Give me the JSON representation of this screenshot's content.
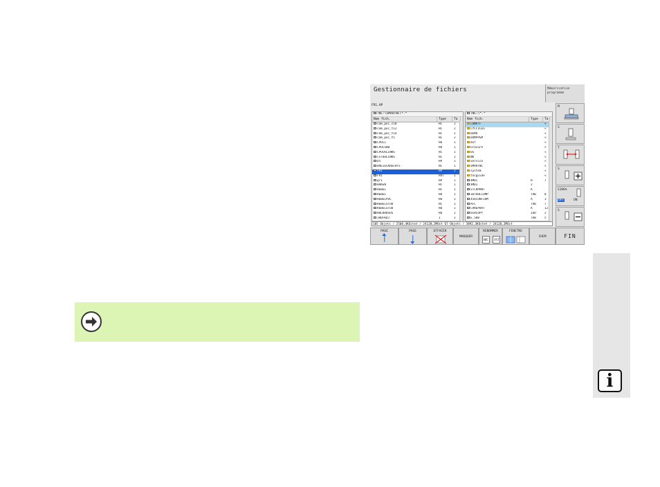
{
  "screen": {
    "title": "Gestionnaire de fichiers",
    "mode_label": "Mémorisation programme",
    "selected_program": "FR1.HP",
    "left_panel": {
      "path": "TNC:\\SMARTNC\\*.*",
      "columns": [
        "Nom fich.",
        "Type",
        "Ta"
      ],
      "rows": [
        {
          "name": "cam_poc_c50",
          "type": "HC",
          "size": "1"
        },
        {
          "name": "cam_poc_t12",
          "type": "HC",
          "size": "2"
        },
        {
          "name": "cam_poc_t14",
          "type": "HC",
          "size": "2"
        },
        {
          "name": "cam_poc_t5",
          "type": "HC",
          "size": "2"
        },
        {
          "name": "CPOC1",
          "type": "HU",
          "size": "1"
        },
        {
          "name": "CPOCSHB",
          "type": "HU",
          "size": "1"
        },
        {
          "name": "CPOCKLINKS",
          "type": "HC",
          "size": "1"
        },
        {
          "name": "CSTUDLINKS",
          "type": "HC",
          "size": "1"
        },
        {
          "name": "D5",
          "type": "HP",
          "size": "1"
        },
        {
          "name": "DREIECKRECHTS",
          "type": "HC",
          "size": "1"
        },
        {
          "name": "FR1",
          "type": "HP",
          "size": "2"
        },
        {
          "name": "FR1",
          "type": "HVT",
          "size": "1"
        },
        {
          "name": "gr1",
          "type": "HP",
          "size": "1"
        },
        {
          "name": "HAKEN",
          "type": "HC",
          "size": "1"
        },
        {
          "name": "HEBEL",
          "type": "HC",
          "size": "1"
        },
        {
          "name": "HEBEL",
          "type": "HU",
          "size": "1"
        },
        {
          "name": "HEBELPOC",
          "type": "HU",
          "size": "1"
        },
        {
          "name": "HEBELSTUD",
          "type": "HC",
          "size": "1"
        },
        {
          "name": "HEBELSTUD",
          "type": "HU",
          "size": "1"
        },
        {
          "name": "HOLKRDSUS",
          "type": "HU",
          "size": "1"
        },
        {
          "name": "JHDFKDJ",
          "type": "I",
          "size": "1"
        }
      ]
    },
    "right_panel": {
      "path": "TNC:\\*.*",
      "columns": [
        "Nom fich.",
        "Type",
        "Ta"
      ],
      "rows": [
        {
          "name": "CONVTF",
          "type": "",
          "size": "<",
          "folder": true
        },
        {
          "name": "CYCFILES",
          "type": "",
          "size": "<",
          "folder": true
        },
        {
          "name": "DEMO",
          "type": "",
          "size": "<",
          "folder": true
        },
        {
          "name": "DUMPPGM",
          "type": "",
          "size": "<",
          "folder": true
        },
        {
          "name": "dxf",
          "type": "",
          "size": "<",
          "folder": true
        },
        {
          "name": "Gravure",
          "type": "",
          "size": "<",
          "folder": true
        },
        {
          "name": "OS",
          "type": "",
          "size": "<",
          "folder": true
        },
        {
          "name": "NK",
          "type": "",
          "size": "<",
          "folder": true
        },
        {
          "name": "Service",
          "type": "",
          "size": "<",
          "folder": true
        },
        {
          "name": "SMARTNC",
          "type": "",
          "size": "<",
          "folder": true
        },
        {
          "name": "system",
          "type": "",
          "size": "<",
          "folder": true
        },
        {
          "name": "tncguide",
          "type": "",
          "size": "<",
          "folder": true
        },
        {
          "name": "$MDI",
          "type": "H",
          "size": "7",
          "folder": false
        },
        {
          "name": "$MDI",
          "type": "I",
          "size": "",
          "folder": false
        },
        {
          "name": "STCHPRNT",
          "type": "A",
          "size": "",
          "folder": false
        },
        {
          "name": "3DTOOLCOMP",
          "type": "TAB",
          "size": "8",
          "folder": false
        },
        {
          "name": "4S4CONFIRM",
          "type": "A",
          "size": "3",
          "folder": false
        },
        {
          "name": "AFC",
          "type": "TAB",
          "size": "7",
          "folder": false
        },
        {
          "name": "CVREPORT",
          "type": "A",
          "size": "12",
          "folder": false
        },
        {
          "name": "DIRCOPY",
          "type": "JOU",
          "size": "2",
          "folder": false
        },
        {
          "name": "E_500",
          "type": "TAB",
          "size": "5",
          "folder": false
        }
      ]
    },
    "status": "105 Objets / 2508,4KOctet / 24120,2MOct   67 Objets / 3892,3KOctet / 24120,2MOct",
    "vertical_softkeys": [
      {
        "label": "M",
        "icon": "m-function-icon"
      },
      {
        "label": "S",
        "icon": "spindle-icon"
      },
      {
        "label": "T",
        "icon": "tool-axis-icon"
      },
      {
        "label": "S",
        "icon": "spindle-override-plus-icon"
      },
      {
        "label": "S100%",
        "icon": "override-off-on-icon",
        "off": "OFF",
        "on": "ON"
      },
      {
        "label": "S",
        "icon": "spindle-override-minus-icon"
      }
    ],
    "softkeys": [
      {
        "label": "PAGE",
        "icon": "arrow-up-icon"
      },
      {
        "label": "PAGE",
        "icon": "arrow-down-icon"
      },
      {
        "label": "EFFACER",
        "icon": "delete-icon"
      },
      {
        "label": "MARQUER",
        "icon": ""
      },
      {
        "label": "RENOMMER",
        "icon": "rename-icon",
        "from": "ABC",
        "to": "XYZ"
      },
      {
        "label": "FENETRE",
        "icon": "window-icon"
      },
      {
        "label": "CHEM",
        "icon": ""
      },
      {
        "label": "FIN",
        "icon": ""
      }
    ]
  },
  "note": {
    "icon": "arrow-right-circle-icon"
  },
  "info": {
    "icon": "info-icon",
    "label": "i"
  }
}
